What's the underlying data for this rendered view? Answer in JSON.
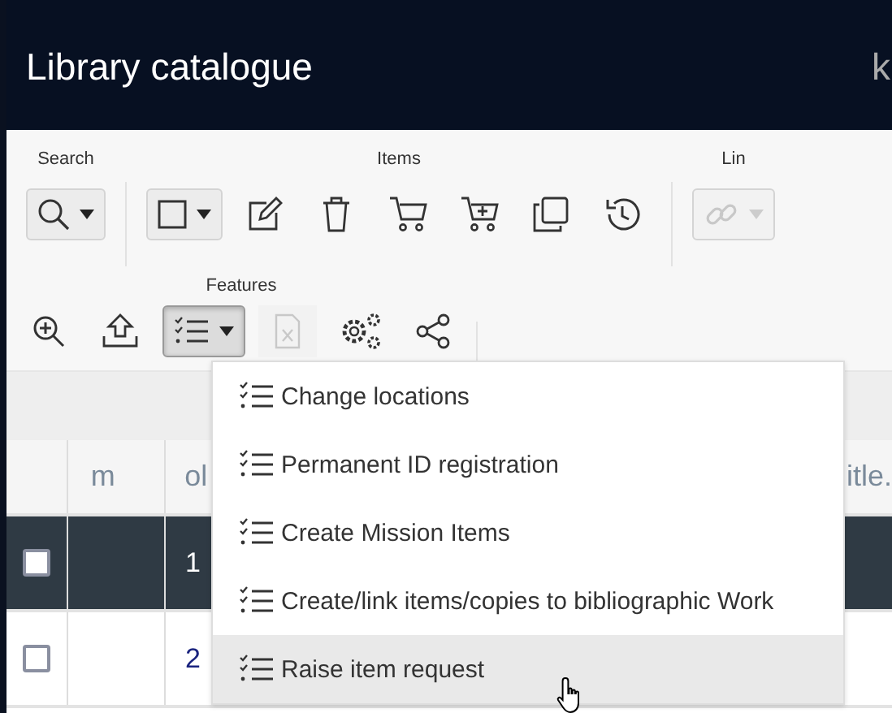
{
  "header": {
    "title": "Library catalogue",
    "right_text": "k"
  },
  "toolbar": {
    "groups": [
      {
        "label": "Search",
        "tools": [
          {
            "kind": "search",
            "dropdown": true,
            "disabled": false
          }
        ]
      },
      {
        "label": "Items",
        "tools": [
          {
            "kind": "select",
            "dropdown": true,
            "disabled": false
          },
          {
            "kind": "edit",
            "dropdown": false,
            "disabled": false
          },
          {
            "kind": "delete",
            "dropdown": false,
            "disabled": false
          },
          {
            "kind": "cart",
            "dropdown": false,
            "disabled": false
          },
          {
            "kind": "cart-add",
            "dropdown": false,
            "disabled": false
          },
          {
            "kind": "copy",
            "dropdown": false,
            "disabled": false
          },
          {
            "kind": "history",
            "dropdown": false,
            "disabled": false
          }
        ]
      },
      {
        "label": "Lin",
        "tools": [
          {
            "kind": "link",
            "dropdown": true,
            "disabled": true
          }
        ]
      }
    ],
    "features": {
      "label": "Features",
      "tools": [
        {
          "kind": "zoom",
          "dropdown": false,
          "disabled": false,
          "expanded": false
        },
        {
          "kind": "upload",
          "dropdown": false,
          "disabled": false,
          "expanded": false
        },
        {
          "kind": "checklist",
          "dropdown": true,
          "disabled": false,
          "expanded": true
        },
        {
          "kind": "excel",
          "dropdown": false,
          "disabled": true,
          "expanded": false
        },
        {
          "kind": "settings",
          "dropdown": false,
          "disabled": false,
          "expanded": false
        },
        {
          "kind": "share",
          "dropdown": false,
          "disabled": false,
          "expanded": false
        }
      ]
    }
  },
  "menu": {
    "items": [
      {
        "label": "Change locations",
        "hovered": false
      },
      {
        "label": "Permanent ID registration",
        "hovered": false
      },
      {
        "label": "Create Mission Items",
        "hovered": false
      },
      {
        "label": "Create/link items/copies to bibliographic Work",
        "hovered": false
      },
      {
        "label": "Raise item request",
        "hovered": true
      }
    ]
  },
  "table": {
    "columns": [
      "m",
      "ol",
      "itle."
    ],
    "rows": [
      {
        "checked": false,
        "selected": true,
        "cells": [
          "",
          "1",
          ""
        ]
      },
      {
        "checked": false,
        "selected": false,
        "cells": [
          "",
          "2",
          ""
        ]
      }
    ]
  }
}
